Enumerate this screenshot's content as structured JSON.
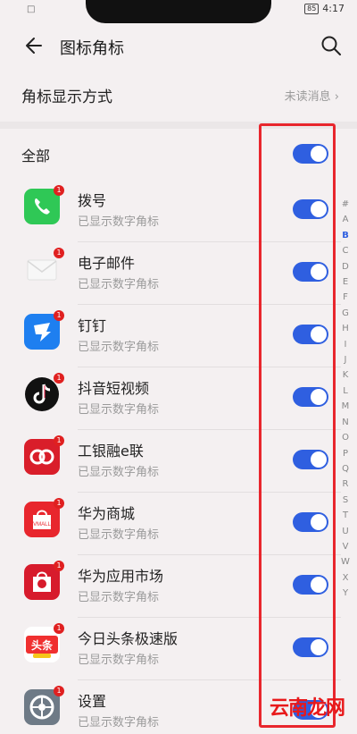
{
  "status": {
    "left": "□",
    "battery": "85",
    "time": "4:17"
  },
  "header": {
    "title": "图标角标"
  },
  "badge_mode": {
    "label": "角标显示方式",
    "value": "未读消息"
  },
  "all": {
    "label": "全部",
    "enabled": true
  },
  "apps": [
    {
      "name": "拨号",
      "sub": "已显示数字角标",
      "icon": "phone-icon",
      "badge": "1",
      "enabled": true
    },
    {
      "name": "电子邮件",
      "sub": "已显示数字角标",
      "icon": "email-icon",
      "badge": "1",
      "enabled": true
    },
    {
      "name": "钉钉",
      "sub": "已显示数字角标",
      "icon": "dingtalk-icon",
      "badge": "1",
      "enabled": true
    },
    {
      "name": "抖音短视频",
      "sub": "已显示数字角标",
      "icon": "tiktok-icon",
      "badge": "1",
      "enabled": true
    },
    {
      "name": "工银融e联",
      "sub": "已显示数字角标",
      "icon": "icbc-icon",
      "badge": "1",
      "enabled": true
    },
    {
      "name": "华为商城",
      "sub": "已显示数字角标",
      "icon": "vmall-icon",
      "badge": "1",
      "enabled": true
    },
    {
      "name": "华为应用市场",
      "sub": "已显示数字角标",
      "icon": "appgallery-icon",
      "badge": "1",
      "enabled": true
    },
    {
      "name": "今日头条极速版",
      "sub": "已显示数字角标",
      "icon": "toutiao-icon",
      "badge": "1",
      "enabled": true
    },
    {
      "name": "设置",
      "sub": "已显示数字角标",
      "icon": "settings-icon",
      "badge": "1",
      "enabled": true
    }
  ],
  "icon_texts": {
    "vmall": "VMALL",
    "toutiao": "头条"
  },
  "index": [
    "#",
    "A",
    "B",
    "C",
    "D",
    "E",
    "F",
    "G",
    "H",
    "I",
    "J",
    "K",
    "L",
    "M",
    "N",
    "O",
    "P",
    "Q",
    "R",
    "S",
    "T",
    "U",
    "V",
    "W",
    "X",
    "Y"
  ],
  "active_index": "B",
  "watermark": "云南龙网",
  "colors": {
    "accent": "#2f5fe0",
    "highlight": "#e8262d",
    "badge": "#e02020"
  }
}
